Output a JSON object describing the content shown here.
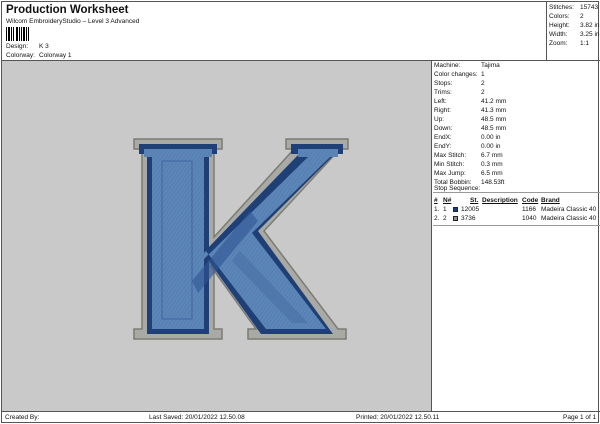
{
  "header": {
    "title": "Production Worksheet",
    "subtitle": "Wilcom EmbroideryStudio – Level 3 Advanced",
    "design_label": "Design:",
    "design_value": "K 3",
    "colorway_label": "Colorway:",
    "colorway_value": "Colorway 1"
  },
  "stats": [
    {
      "label": "Stitches:",
      "value": "15743"
    },
    {
      "label": "Colors:",
      "value": "2"
    },
    {
      "label": "Height:",
      "value": "3.82 in"
    },
    {
      "label": "Width:",
      "value": "3.25 in"
    },
    {
      "label": "Zoom:",
      "value": "1:1"
    }
  ],
  "machine_info": [
    {
      "label": "Machine:",
      "value": "Tajima"
    },
    {
      "label": "Color changes:",
      "value": "1"
    },
    {
      "label": "Stops:",
      "value": "2"
    },
    {
      "label": "Trims:",
      "value": "2"
    },
    {
      "label": "Left:",
      "value": "41.2 mm"
    },
    {
      "label": "Right:",
      "value": "41.3 mm"
    },
    {
      "label": "Up:",
      "value": "48.5 mm"
    },
    {
      "label": "Down:",
      "value": "48.5 mm"
    },
    {
      "label": "EndX:",
      "value": "0.00 in"
    },
    {
      "label": "EndY:",
      "value": "0.00 in"
    },
    {
      "label": "Max Stitch:",
      "value": "6.7 mm"
    },
    {
      "label": "Min Stitch:",
      "value": "0.3 mm"
    },
    {
      "label": "Max Jump:",
      "value": "6.5 mm"
    },
    {
      "label": "Total Bobbin:",
      "value": "148.53ft"
    }
  ],
  "stop_sequence": {
    "label": "Stop Sequence:",
    "columns": [
      "#",
      "N#",
      "St.",
      "Description",
      "Code",
      "Brand"
    ],
    "rows": [
      {
        "num": "1.",
        "n": "1",
        "color": "#1f3f77",
        "st": "12005",
        "description": "",
        "code": "1166",
        "brand": "Madeira Classic 40"
      },
      {
        "num": "2.",
        "n": "2",
        "color": "#8f8f8f",
        "st": "3736",
        "description": "",
        "code": "1040",
        "brand": "Madeira Classic 40"
      }
    ]
  },
  "footer": {
    "created_by": "Created By:",
    "last_saved": "Last Saved: 20/01/2022 12.50.08",
    "printed": "Printed: 20/01/2022 12.50.11",
    "page": "Page 1 of 1"
  },
  "colors": {
    "canvas_bg": "#c9c9c9",
    "letter_fill": "#5d86b8",
    "letter_outline": "#1f3f77",
    "letter_border": "#8f8f8f"
  }
}
